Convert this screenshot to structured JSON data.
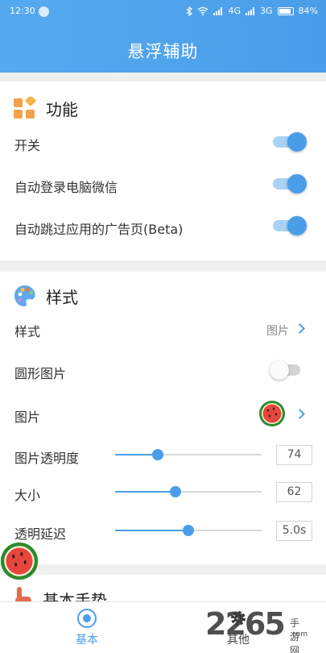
{
  "status_bar": {
    "time": "12:30",
    "network_4g": "4G",
    "network_3g": "3G",
    "battery": "84%"
  },
  "header": {
    "title": "悬浮辅助"
  },
  "function_section": {
    "title": "功能",
    "items": [
      {
        "label": "开关",
        "state": "on"
      },
      {
        "label": "自动登录电脑微信",
        "state": "on"
      },
      {
        "label": "自动跳过应用的广告页(Beta)",
        "state": "on"
      }
    ]
  },
  "style_section": {
    "title": "样式",
    "style_row": {
      "label": "样式",
      "value": "图片"
    },
    "round_image": {
      "label": "圆形图片",
      "state": "off"
    },
    "image_row": {
      "label": "图片"
    },
    "sliders": [
      {
        "label": "图片透明度",
        "value": "74",
        "fraction": 0.29
      },
      {
        "label": "大小",
        "value": "62",
        "fraction": 0.41
      },
      {
        "label": "透明延迟",
        "value": "5.0s",
        "fraction": 0.5
      }
    ]
  },
  "gesture_section": {
    "title": "基本手势"
  },
  "bottom_nav": {
    "base_label": "基本",
    "other_label": "其他"
  },
  "watermark": {
    "main": "2265",
    "sub": "手游网",
    "url": ".com"
  },
  "colors": {
    "accent": "#4a9ee9",
    "header_start": "#55a9ef"
  }
}
